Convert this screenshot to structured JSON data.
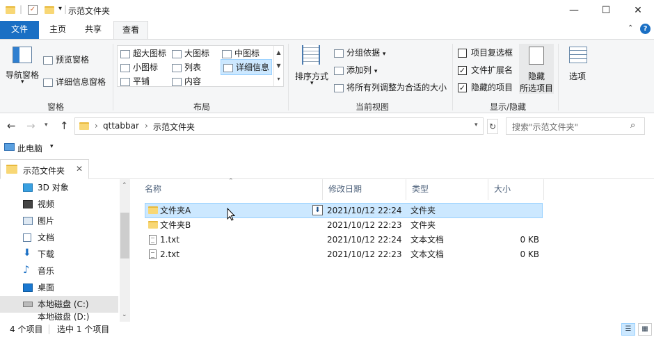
{
  "window": {
    "title": "示范文件夹",
    "minimize": "—",
    "maximize": "☐",
    "close": "✕"
  },
  "ribbon_tabs": [
    {
      "label": "文件"
    },
    {
      "label": "主页"
    },
    {
      "label": "共享"
    },
    {
      "label": "查看"
    }
  ],
  "ribbon": {
    "panes": {
      "navigation_pane": "导航窗格",
      "preview_pane": "预览窗格",
      "details_pane": "详细信息窗格",
      "group_label": "窗格"
    },
    "layout": {
      "items": [
        "超大图标",
        "大图标",
        "中图标",
        "小图标",
        "列表",
        "详细信息",
        "平铺",
        "内容"
      ],
      "selected": "详细信息",
      "group_label": "布局"
    },
    "current_view": {
      "sort_by": "排序方式",
      "group_by": "分组依据",
      "add_columns": "添加列",
      "fit_columns": "将所有列调整为合适的大小",
      "group_label": "当前视图"
    },
    "show_hide": {
      "item_checkboxes": {
        "label": "项目复选框",
        "checked": false
      },
      "file_extensions": {
        "label": "文件扩展名",
        "checked": true
      },
      "hidden_items": {
        "label": "隐藏的项目",
        "checked": true
      },
      "hide_selected_line1": "隐藏",
      "hide_selected_line2": "所选项目",
      "group_label": "显示/隐藏"
    },
    "options": "选项"
  },
  "address": {
    "breadcrumb": [
      "qttabbar",
      "示范文件夹"
    ],
    "search_placeholder": "搜索\"示范文件夹\""
  },
  "pc_label": "此电脑",
  "qt_tab": {
    "label": "示范文件夹"
  },
  "nav_items": [
    {
      "label": "3D 对象",
      "icon": "cube-icon"
    },
    {
      "label": "视频",
      "icon": "video-icon"
    },
    {
      "label": "图片",
      "icon": "picture-icon"
    },
    {
      "label": "文档",
      "icon": "document-icon"
    },
    {
      "label": "下载",
      "icon": "download-icon"
    },
    {
      "label": "音乐",
      "icon": "music-icon"
    },
    {
      "label": "桌面",
      "icon": "desktop-icon"
    },
    {
      "label": "本地磁盘 (C:)",
      "icon": "drive-icon"
    },
    {
      "label": "本地磁盘 (D:)",
      "icon": "drive-icon"
    }
  ],
  "columns": {
    "name": "名称",
    "modified": "修改日期",
    "type": "类型",
    "size": "大小"
  },
  "files": [
    {
      "name": "文件夹A",
      "modified": "2021/10/12 22:24",
      "type": "文件夹",
      "size": "",
      "kind": "folder",
      "selected": true
    },
    {
      "name": "文件夹B",
      "modified": "2021/10/12 22:23",
      "type": "文件夹",
      "size": "",
      "kind": "folder",
      "selected": false
    },
    {
      "name": "1.txt",
      "modified": "2021/10/12 22:24",
      "type": "文本文档",
      "size": "0 KB",
      "kind": "file",
      "selected": false
    },
    {
      "name": "2.txt",
      "modified": "2021/10/12 22:23",
      "type": "文本文档",
      "size": "0 KB",
      "kind": "file",
      "selected": false
    }
  ],
  "status": {
    "count": "4 个项目",
    "selection": "选中 1 个项目"
  },
  "colors": {
    "accent": "#1a6fc4",
    "selection": "#cce8ff",
    "selection_border": "#99d1ff"
  }
}
